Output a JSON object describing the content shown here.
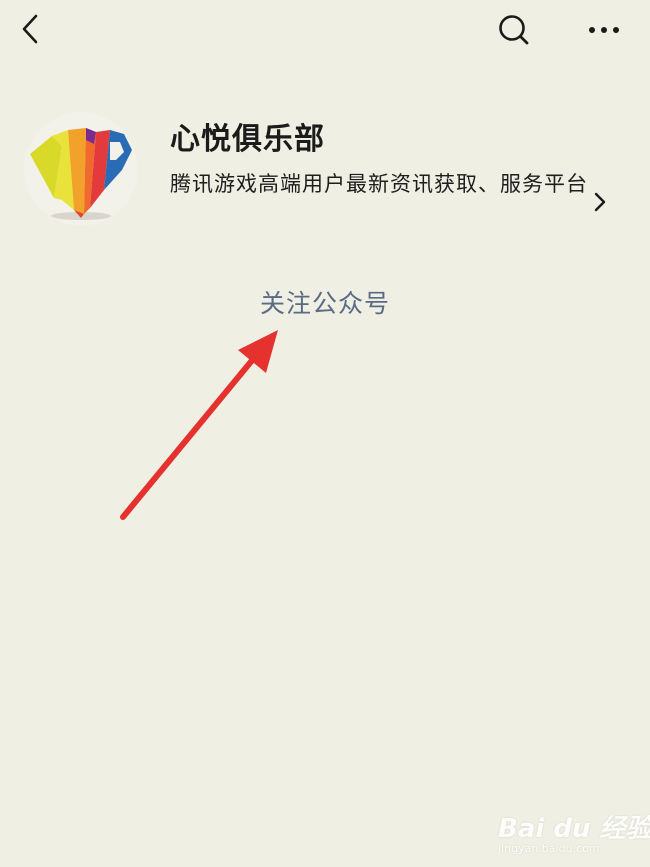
{
  "nav": {
    "back_icon": "chevron-left-icon",
    "search_icon": "search-icon",
    "more_icon": "more-horizontal-icon"
  },
  "account": {
    "name": "心悦俱乐部",
    "description": "腾讯游戏高端用户最新资讯获取、服务平台",
    "logo": "vip-shield-logo",
    "detail_icon": "chevron-right-icon"
  },
  "actions": {
    "follow_label": "关注公众号"
  },
  "annotation": {
    "arrow_color": "#e5322e"
  },
  "watermark": {
    "brand": "Bai du 经验",
    "url": "jingyan.baidu.com"
  },
  "colors": {
    "background": "#efefe3",
    "link": "#5a6b84"
  }
}
